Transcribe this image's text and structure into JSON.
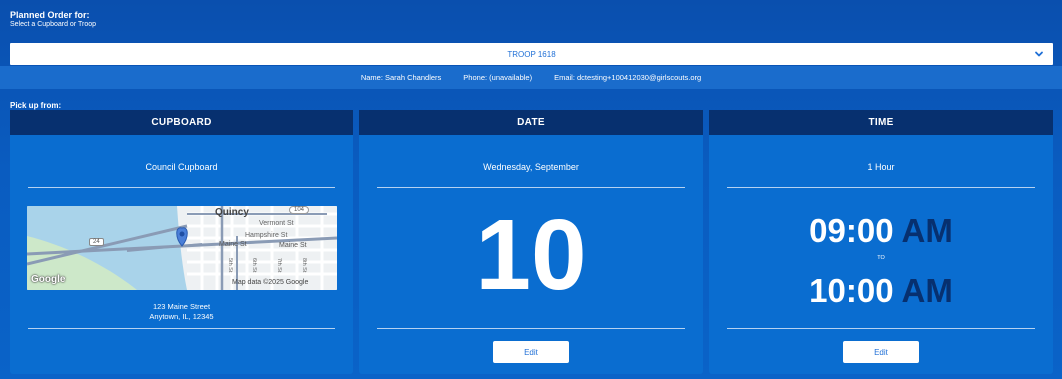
{
  "header": {
    "title": "Planned Order for:",
    "subtitle": "Select a Cupboard or Troop"
  },
  "select": {
    "value": "TROOP 1618"
  },
  "contact": {
    "name": "Name: Sarah Chandlers",
    "phone": "Phone: (unavailable)",
    "email": "Email: dctesting+100412030@girlscouts.org"
  },
  "pickup_label": "Pick up from:",
  "cupboard": {
    "heading": "CUPBOARD",
    "name": "Council Cupboard",
    "address_line1": "123 Maine Street",
    "address_line2": "Anytown, IL, 12345",
    "map": {
      "city": "Quincy",
      "streets": [
        "Vermont St",
        "Hampshire St",
        "Maine St",
        "Maine St"
      ],
      "avenues": [
        "5th St",
        "6th St",
        "7th St",
        "8th St"
      ],
      "route_shield_top": "104",
      "route_shield_left": "24",
      "logo": "Google",
      "attribution": "Map data ©2025 Google"
    }
  },
  "date": {
    "heading": "DATE",
    "weekday_month": "Wednesday, September",
    "day": "10",
    "edit_label": "Edit"
  },
  "time": {
    "heading": "TIME",
    "duration": "1 Hour",
    "start_time": "09:00",
    "start_ampm": "AM",
    "to_label": "TO",
    "end_time": "10:00",
    "end_ampm": "AM",
    "edit_label": "Edit"
  },
  "colors": {
    "background": "#0a5cc0",
    "panel": "#0a6dd0",
    "panel_header": "#07306f",
    "accent_text": "#1f6fd6"
  }
}
